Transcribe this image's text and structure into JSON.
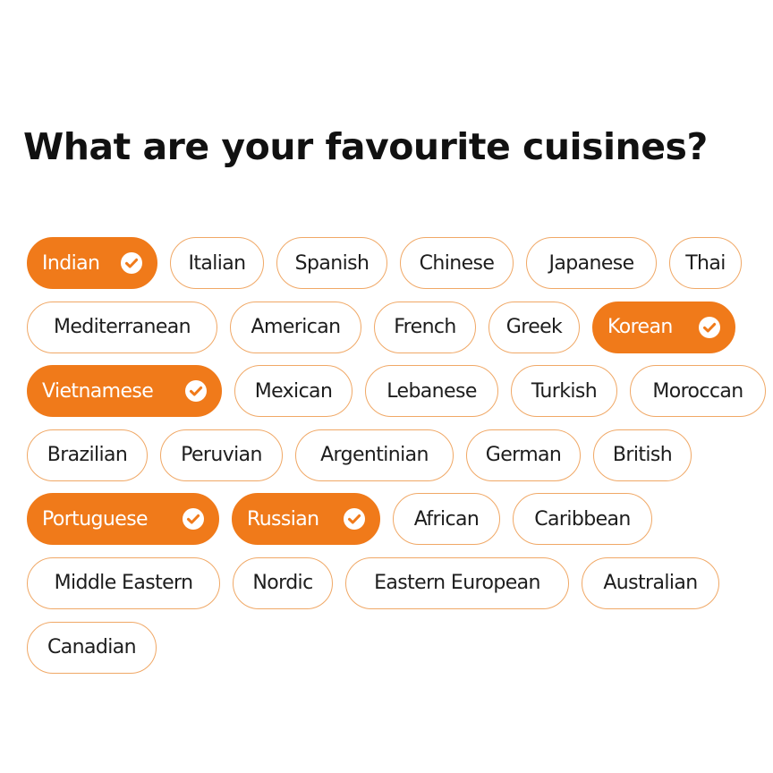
{
  "page": {
    "title": "What are your favourite cuisines?"
  },
  "colors": {
    "accent": "#f07a1a",
    "chip_border": "#f0a866",
    "text": "#1d1d1d"
  },
  "icons": {
    "selected": "check-circle-icon"
  },
  "cuisines": {
    "indian": {
      "label": "Indian",
      "selected": true
    },
    "italian": {
      "label": "Italian",
      "selected": false
    },
    "spanish": {
      "label": "Spanish",
      "selected": false
    },
    "chinese": {
      "label": "Chinese",
      "selected": false
    },
    "japanese": {
      "label": "Japanese",
      "selected": false
    },
    "thai": {
      "label": "Thai",
      "selected": false
    },
    "mediterranean": {
      "label": "Mediterranean",
      "selected": false
    },
    "american": {
      "label": "American",
      "selected": false
    },
    "french": {
      "label": "French",
      "selected": false
    },
    "greek": {
      "label": "Greek",
      "selected": false
    },
    "korean": {
      "label": "Korean",
      "selected": true
    },
    "vietnamese": {
      "label": "Vietnamese",
      "selected": true
    },
    "mexican": {
      "label": "Mexican",
      "selected": false
    },
    "lebanese": {
      "label": "Lebanese",
      "selected": false
    },
    "turkish": {
      "label": "Turkish",
      "selected": false
    },
    "moroccan": {
      "label": "Moroccan",
      "selected": false
    },
    "brazilian": {
      "label": "Brazilian",
      "selected": false
    },
    "peruvian": {
      "label": "Peruvian",
      "selected": false
    },
    "argentinian": {
      "label": "Argentinian",
      "selected": false
    },
    "german": {
      "label": "German",
      "selected": false
    },
    "british": {
      "label": "British",
      "selected": false
    },
    "portuguese": {
      "label": "Portuguese",
      "selected": true
    },
    "russian": {
      "label": "Russian",
      "selected": true
    },
    "african": {
      "label": "African",
      "selected": false
    },
    "caribbean": {
      "label": "Caribbean",
      "selected": false
    },
    "middle_eastern": {
      "label": "Middle Eastern",
      "selected": false
    },
    "nordic": {
      "label": "Nordic",
      "selected": false
    },
    "eastern_european": {
      "label": "Eastern European",
      "selected": false
    },
    "australian": {
      "label": "Australian",
      "selected": false
    },
    "canadian": {
      "label": "Canadian",
      "selected": false
    }
  }
}
